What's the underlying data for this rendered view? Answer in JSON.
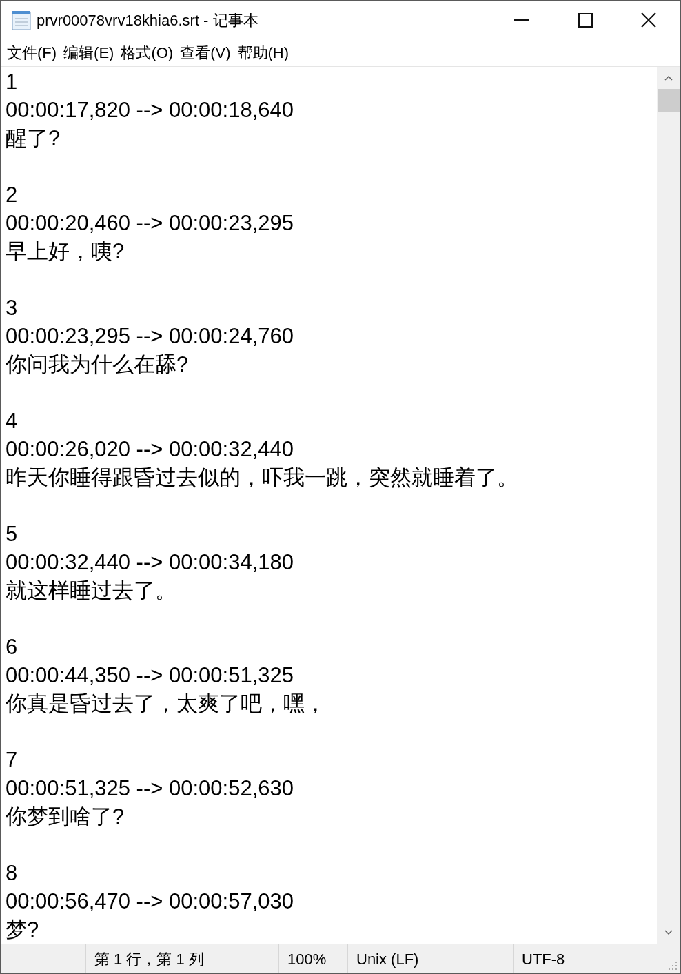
{
  "window": {
    "title": "prvr00078vrv18khia6.srt - 记事本"
  },
  "menu": [
    "文件(F)",
    "编辑(E)",
    "格式(O)",
    "查看(V)",
    "帮助(H)"
  ],
  "subtitles": [
    {
      "index": "1",
      "time": "00:00:17,820 --> 00:00:18,640",
      "text": "醒了?"
    },
    {
      "index": "2",
      "time": "00:00:20,460 --> 00:00:23,295",
      "text": "早上好，咦?"
    },
    {
      "index": "3",
      "time": "00:00:23,295 --> 00:00:24,760",
      "text": "你问我为什么在舔?"
    },
    {
      "index": "4",
      "time": "00:00:26,020 --> 00:00:32,440",
      "text": "昨天你睡得跟昏过去似的，吓我一跳，突然就睡着了。"
    },
    {
      "index": "5",
      "time": "00:00:32,440 --> 00:00:34,180",
      "text": "就这样睡过去了。"
    },
    {
      "index": "6",
      "time": "00:00:44,350 --> 00:00:51,325",
      "text": "你真是昏过去了，太爽了吧，嘿，"
    },
    {
      "index": "7",
      "time": "00:00:51,325 --> 00:00:52,630",
      "text": "你梦到啥了?"
    },
    {
      "index": "8",
      "time": "00:00:56,470 --> 00:00:57,030",
      "text": "梦?"
    }
  ],
  "status_bar": [
    "第 1 行，第 1 列",
    "100%",
    "Unix (LF)",
    "UTF-8"
  ]
}
